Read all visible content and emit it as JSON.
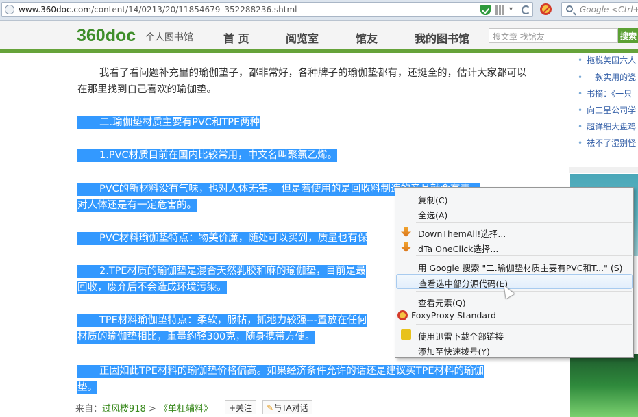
{
  "browser": {
    "url_host": "www.360doc.com",
    "url_path": "/content/14/0213/20/11854679_352288236.shtml",
    "search_placeholder": "Google <Ctrl+K>"
  },
  "site": {
    "logo": "360doc",
    "logo_sub": "个人图书馆",
    "nav": [
      "首 页",
      "阅览室",
      "馆友",
      "我的图书馆"
    ],
    "search_placeholder": "搜文章  找馆友",
    "search_button": "搜索"
  },
  "article": {
    "p1": "我看了看问题补充里的瑜伽垫子，都非常好，各种牌子的瑜伽垫都有，还挺全的，估计大家都可以在那里找到自己喜欢的瑜伽垫。",
    "p2": "二.瑜伽垫材质主要有PVC和TPE两种",
    "p3": "1.PVC材质目前在国内比较常用，中文名叫聚氯乙烯。",
    "p4a": "PVC的新材料没有气味，也对人体无害。  但是若使用的是回收料制造的产品就会有毒，",
    "p4b": "对人体还是有一定危害的。",
    "p5": "PVC材料瑜伽垫特点：物美价廉，随处可以买到，质量也有保",
    "p6a": "2.TPE材质的瑜伽垫是混合天然乳胶和麻的瑜伽垫，目前是最",
    "p6b": "回收，废弃后不会造成环境污染。",
    "p7a": "TPE材料瑜伽垫特点：柔软，服帖，抓地力较强---置放在任何",
    "p7b": "材质的瑜伽垫相比，重量约轻300克，随身携带方便。",
    "p8a": "正因如此TPE材料的瑜伽垫价格偏高。如果经济条件允许的话还是建议买TPE材料的瑜伽",
    "p8b": "垫。",
    "source_label": "来自：",
    "source_user": "过风楼918",
    "source_sep": " > ",
    "source_category": "《单杠辅料》",
    "follow": "+关注",
    "chat": "与TA对话"
  },
  "sidebar": {
    "items": [
      "拖税美国六人",
      "一款实用的瓷",
      "书摘：《一只",
      "向三星公司学",
      "超详细大盘鸡",
      "祛不了湿别怪"
    ]
  },
  "context_menu": {
    "items": [
      "复制(C)",
      "全选(A)",
      "DownThemAll!选择...",
      "dTa OneClick选择...",
      "用 Google 搜索 \"二.瑜伽垫材质主要有PVC和T...\" (S)",
      "查看选中部分源代码(E)",
      "查看元素(Q)",
      "FoxyProxy Standard",
      "使用迅雷下载全部链接",
      "添加至快速拨号(Y)"
    ]
  },
  "colors": {
    "selection": "#3399ff",
    "brand_green": "#66a33a",
    "link_blue": "#3560a8"
  }
}
